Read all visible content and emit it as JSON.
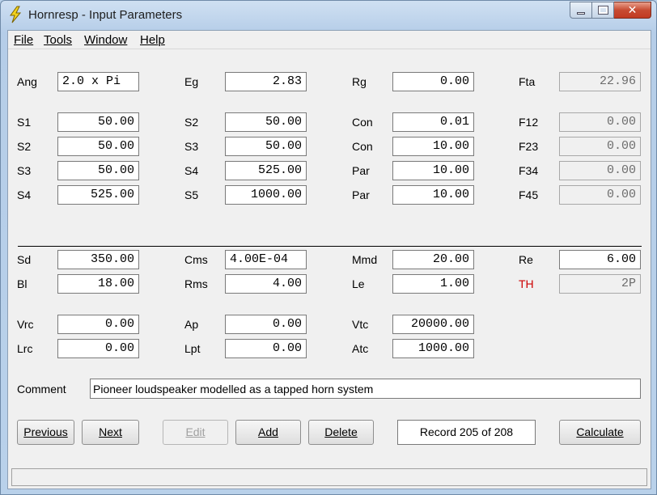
{
  "window": {
    "title": "Hornresp - Input Parameters"
  },
  "menu": {
    "file": "File",
    "tools": "Tools",
    "window": "Window",
    "help": "Help"
  },
  "row_top": {
    "ang": {
      "label": "Ang",
      "value": "2.0 x Pi"
    },
    "eg": {
      "label": "Eg",
      "value": "2.83"
    },
    "rg": {
      "label": "Rg",
      "value": "0.00"
    },
    "fta": {
      "label": "Fta",
      "value": "22.96"
    }
  },
  "horn": [
    {
      "s_label": "S1",
      "s_value": "50.00",
      "s2_label": "S2",
      "s2_value": "50.00",
      "c_label": "Con",
      "c_value": "0.01",
      "f_label": "F12",
      "f_value": "0.00"
    },
    {
      "s_label": "S2",
      "s_value": "50.00",
      "s2_label": "S3",
      "s2_value": "50.00",
      "c_label": "Con",
      "c_value": "10.00",
      "f_label": "F23",
      "f_value": "0.00"
    },
    {
      "s_label": "S3",
      "s_value": "50.00",
      "s2_label": "S4",
      "s2_value": "525.00",
      "c_label": "Par",
      "c_value": "10.00",
      "f_label": "F34",
      "f_value": "0.00"
    },
    {
      "s_label": "S4",
      "s_value": "525.00",
      "s2_label": "S5",
      "s2_value": "1000.00",
      "c_label": "Par",
      "c_value": "10.00",
      "f_label": "F45",
      "f_value": "0.00"
    }
  ],
  "driver": {
    "sd": {
      "label": "Sd",
      "value": "350.00"
    },
    "cms": {
      "label": "Cms",
      "value": "4.00E-04"
    },
    "mmd": {
      "label": "Mmd",
      "value": "20.00"
    },
    "re": {
      "label": "Re",
      "value": "6.00"
    },
    "bl": {
      "label": "Bl",
      "value": "18.00"
    },
    "rms": {
      "label": "Rms",
      "value": "4.00"
    },
    "le": {
      "label": "Le",
      "value": "1.00"
    },
    "th": {
      "label": "TH",
      "value": "2P"
    }
  },
  "chambers": {
    "vrc": {
      "label": "Vrc",
      "value": "0.00"
    },
    "ap": {
      "label": "Ap",
      "value": "0.00"
    },
    "vtc": {
      "label": "Vtc",
      "value": "20000.00"
    },
    "lrc": {
      "label": "Lrc",
      "value": "0.00"
    },
    "lpt": {
      "label": "Lpt",
      "value": "0.00"
    },
    "atc": {
      "label": "Atc",
      "value": "1000.00"
    }
  },
  "comment": {
    "label": "Comment",
    "value": "Pioneer loudspeaker modelled as a tapped horn system"
  },
  "buttons": {
    "previous": "Previous",
    "next": "Next",
    "edit": "Edit",
    "add": "Add",
    "delete": "Delete",
    "record": "Record 205 of 208",
    "calculate": "Calculate"
  },
  "colors": {
    "th_label": "#cc0000",
    "titlebar": "#b9d1ea"
  }
}
